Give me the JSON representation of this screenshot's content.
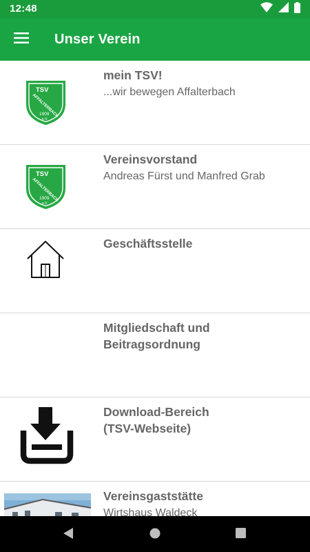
{
  "status_bar": {
    "time": "12:48",
    "icons": [
      "wifi-icon",
      "signal-icon",
      "battery-icon"
    ],
    "color": "#1a9c3c"
  },
  "app_bar": {
    "title": "Unser Verein",
    "menu_icon": "hamburger-menu-icon",
    "color": "#1aa544"
  },
  "logo": {
    "line1": "TSV",
    "line2": "AFFALTERBACH",
    "line3": "1909",
    "line4": "e.V.",
    "color": "#27a844"
  },
  "items": [
    {
      "title": "mein TSV!",
      "subtitle": "...wir bewegen Affalterbach",
      "thumbnail": "tsv-logo"
    },
    {
      "title": "Vereinsvorstand",
      "subtitle": "Andreas Fürst und Manfred Grab",
      "thumbnail": "tsv-logo"
    },
    {
      "title": "Geschäftsstelle",
      "subtitle": "",
      "thumbnail": "house-icon"
    },
    {
      "title": "Mitgliedschaft und\nBeitragsordnung",
      "subtitle": "",
      "thumbnail": ""
    },
    {
      "title": "Download-Bereich\n(TSV-Webseite)",
      "subtitle": "",
      "thumbnail": "download-icon"
    },
    {
      "title": "Vereinsgaststätte",
      "subtitle": "Wirtshaus Waldeck",
      "thumbnail": "restaurant-photo"
    }
  ],
  "nav_bar": {
    "buttons": [
      "back-icon",
      "home-icon",
      "recents-icon"
    ]
  }
}
